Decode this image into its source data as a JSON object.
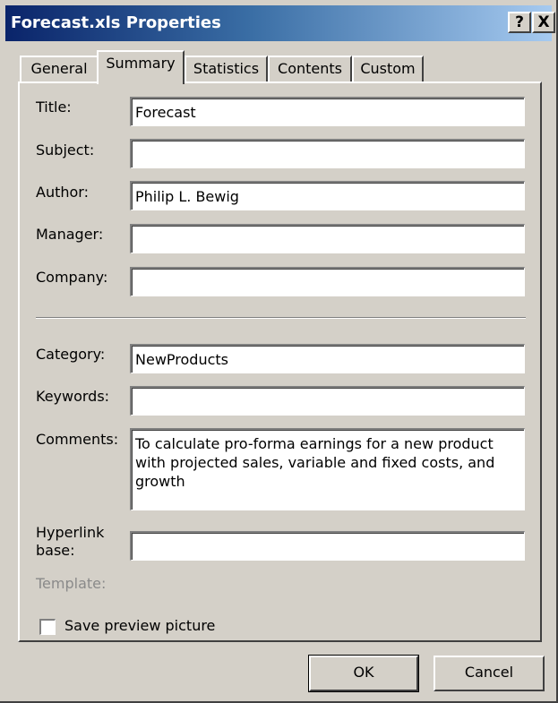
{
  "window": {
    "title": "Forecast.xls Properties",
    "help_label": "?",
    "close_label": "X"
  },
  "tabs": [
    {
      "label": "General"
    },
    {
      "label": "Summary"
    },
    {
      "label": "Statistics"
    },
    {
      "label": "Contents"
    },
    {
      "label": "Custom"
    }
  ],
  "active_tab": "Summary",
  "fields": {
    "title": {
      "label": "Title:",
      "value": "Forecast"
    },
    "subject": {
      "label": "Subject:",
      "value": ""
    },
    "author": {
      "label": "Author:",
      "value": "Philip L. Bewig"
    },
    "manager": {
      "label": "Manager:",
      "value": ""
    },
    "company": {
      "label": "Company:",
      "value": ""
    },
    "category": {
      "label": "Category:",
      "value": "NewProducts"
    },
    "keywords": {
      "label": "Keywords:",
      "value": ""
    },
    "comments": {
      "label": "Comments:",
      "value": "To calculate pro-forma earnings for a new product with projected sales, variable and fixed costs, and growth"
    },
    "hyperlink_base": {
      "label_line1": "Hyperlink",
      "label_line2": "base:",
      "value": ""
    },
    "template": {
      "label": "Template:"
    }
  },
  "save_preview": {
    "label": "Save preview picture",
    "checked": false
  },
  "buttons": {
    "ok": "OK",
    "cancel": "Cancel"
  }
}
